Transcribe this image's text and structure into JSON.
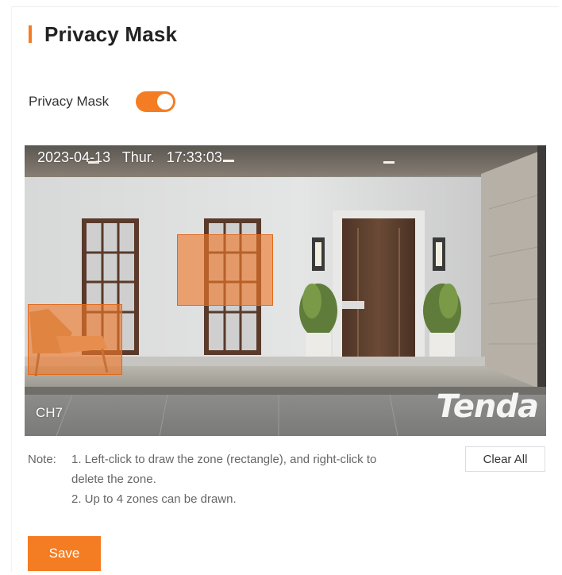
{
  "page": {
    "title": "Privacy Mask",
    "accent_color": "#f47c22"
  },
  "privacy_toggle": {
    "label": "Privacy Mask",
    "enabled": true
  },
  "video": {
    "osd_time": "2023-04-13   Thur.   17:33:03",
    "channel": "CH7",
    "watermark_logo": "Tenda",
    "mask_zone_count": 2
  },
  "note": {
    "prefix": "Note:",
    "line1": "1. Left-click to draw the zone (rectangle), and right-click to",
    "line2": "delete the zone.",
    "line3": "2. Up to 4 zones can be drawn."
  },
  "buttons": {
    "clear_all": "Clear All",
    "save": "Save"
  }
}
